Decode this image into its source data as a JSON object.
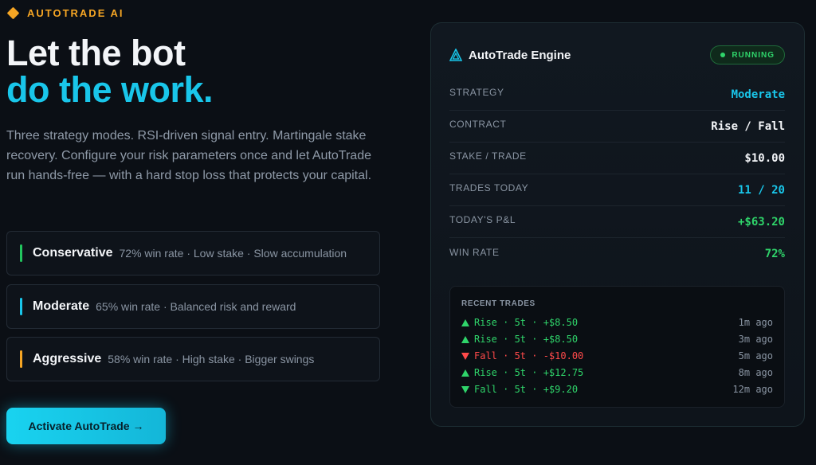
{
  "brand": {
    "name": "AUTOTRADE AI"
  },
  "hero": {
    "line1": "Let the bot",
    "line2": "do the work.",
    "description": "Three strategy modes. RSI-driven signal entry. Martingale stake recovery. Configure your risk parameters once and let AutoTrade run hands-free — with a hard stop loss that protects your capital."
  },
  "modes": [
    {
      "title": "Conservative",
      "info": "72% win rate · Low stake · Slow accumulation",
      "color": "#22c55e"
    },
    {
      "title": "Moderate",
      "info": "65% win rate · Balanced risk and reward",
      "color": "#19c6ea"
    },
    {
      "title": "Aggressive",
      "info": "58% win rate · High stake · Bigger swings",
      "color": "#f5a524"
    }
  ],
  "activate_label": "Activate AutoTrade →",
  "engine": {
    "title": "AutoTrade Engine",
    "status": "RUNNING",
    "rows": [
      {
        "key": "STRATEGY",
        "value": "Moderate",
        "color": "#19c6ea"
      },
      {
        "key": "CONTRACT",
        "value": "Rise / Fall",
        "color": "#f3f5f8"
      },
      {
        "key": "STAKE / TRADE",
        "value": "$10.00",
        "color": "#f3f5f8"
      },
      {
        "key": "TRADES TODAY",
        "value": "11 / 20",
        "color": "#19c6ea"
      },
      {
        "key": "TODAY'S P&L",
        "value": "+$63.20",
        "color": "#2fd46a"
      },
      {
        "key": "WIN RATE",
        "value": "72%",
        "color": "#2fd46a"
      }
    ],
    "recent_title": "RECENT TRADES",
    "trades": [
      {
        "direction": "up",
        "text": "Rise · 5t · +$8.50",
        "ago": "1m ago",
        "color": "#2fd46a"
      },
      {
        "direction": "up",
        "text": "Rise · 5t · +$8.50",
        "ago": "3m ago",
        "color": "#2fd46a"
      },
      {
        "direction": "down",
        "text": "Fall · 5t · -$10.00",
        "ago": "5m ago",
        "color": "#ff4a4a"
      },
      {
        "direction": "up",
        "text": "Rise · 5t · +$12.75",
        "ago": "8m ago",
        "color": "#2fd46a"
      },
      {
        "direction": "down",
        "text": "Fall · 5t · +$9.20",
        "ago": "12m ago",
        "color": "#2fd46a"
      }
    ]
  }
}
